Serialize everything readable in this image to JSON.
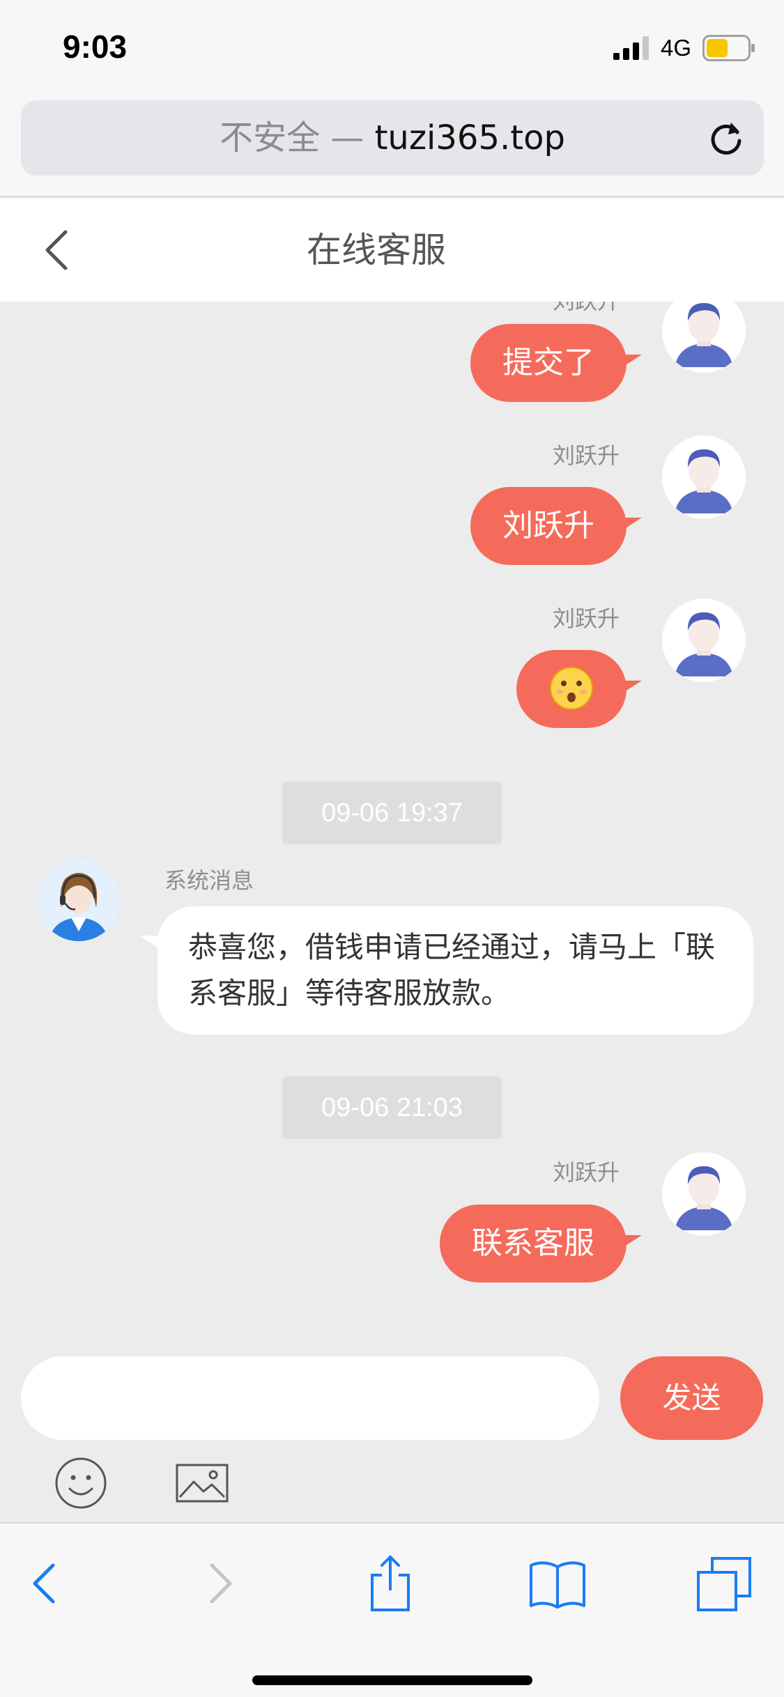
{
  "status_bar": {
    "time": "9:03",
    "network": "4G",
    "battery_color": "#f7c600"
  },
  "address_bar": {
    "security_label": "不安全",
    "separator": " — ",
    "domain": "tuzi365.top"
  },
  "header": {
    "title": "在线客服"
  },
  "chat": {
    "messages": [
      {
        "sender": "刘跃升",
        "text": "提交了",
        "direction": "out"
      },
      {
        "sender": "刘跃升",
        "text": "刘跃升",
        "direction": "out"
      },
      {
        "sender": "刘跃升",
        "text": "",
        "emoji": "hushed-face-emoji",
        "direction": "out"
      }
    ],
    "timestamp_1": "09-06 19:37",
    "system_message": {
      "sender": "系统消息",
      "text": "恭喜您，借钱申请已经通过，请马上「联系客服」等待客服放款。"
    },
    "timestamp_2": "09-06 21:03",
    "last_message": {
      "sender": "刘跃升",
      "text": "联系客服",
      "direction": "out"
    }
  },
  "input": {
    "value": "",
    "send_label": "发送"
  },
  "colors": {
    "accent": "#f56b5b",
    "background": "#ececec",
    "link_blue": "#1a7cf5"
  }
}
